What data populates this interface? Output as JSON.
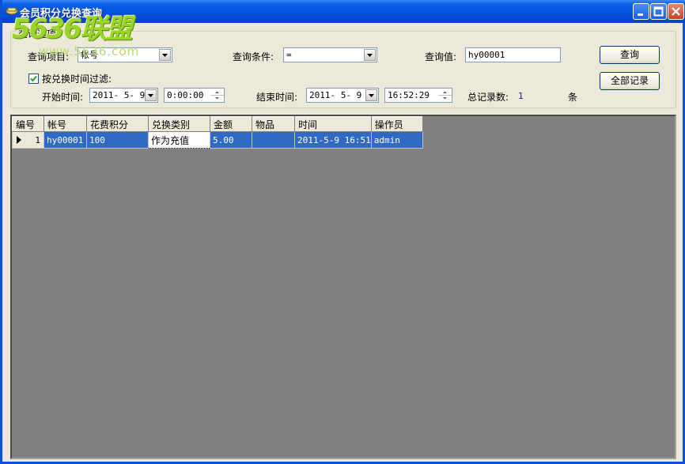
{
  "window": {
    "title": "会员积分兑换查询"
  },
  "watermark": {
    "main": "5636联盟",
    "sub": "www.5636.com"
  },
  "group": {
    "title": "查询选项"
  },
  "query": {
    "item_label": "查询项目:",
    "item_value": "帐号",
    "condition_label": "查询条件:",
    "condition_value": "=",
    "value_label": "查询值:",
    "value_value": "hy00001",
    "search_button": "查询",
    "all_button": "全部记录"
  },
  "filter": {
    "checkbox_label": "按兑换时间过滤:",
    "checked": true,
    "start_label": "开始时间:",
    "start_date": "2011- 5- 9",
    "start_time": "0:00:00",
    "end_label": "结束时间:",
    "end_date": "2011- 5- 9",
    "end_time": "16:52:29",
    "total_label": "总记录数:",
    "total_value": "1",
    "total_unit": "条"
  },
  "table": {
    "headers": [
      "编号",
      "帐号",
      "花费积分",
      "兑换类别",
      "金额",
      "物品",
      "时间",
      "操作员"
    ],
    "rows": [
      [
        "1",
        "hy00001",
        "100",
        "作为充值",
        "5.00",
        "",
        "2011-5-9 16:51",
        "admin"
      ]
    ]
  }
}
